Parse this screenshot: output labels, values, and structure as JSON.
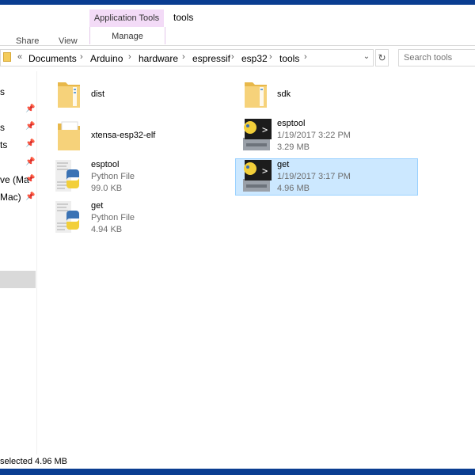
{
  "ribbon": {
    "tabs": [
      "Share",
      "View"
    ],
    "contextual_header": "Application Tools",
    "contextual_tab": "Manage"
  },
  "window": {
    "title": "tools"
  },
  "address": {
    "breadcrumbs": [
      "Documents",
      "Arduino",
      "hardware",
      "espressif",
      "esp32",
      "tools"
    ],
    "overflow": "«",
    "separator": "›"
  },
  "search": {
    "placeholder": "Search tools"
  },
  "nav": {
    "items": [
      "s",
      "s",
      "ts",
      "",
      "ve (Ma",
      "Mac)"
    ]
  },
  "files": [
    {
      "name": "dist",
      "type": "folder"
    },
    {
      "name": "sdk",
      "type": "folder"
    },
    {
      "name": "xtensa-esp32-elf",
      "type": "document-folder"
    },
    {
      "name": "esptool",
      "date": "1/19/2017 3:22 PM",
      "size": "3.29 MB",
      "type": "exe"
    },
    {
      "name": "esptool",
      "kind": "Python File",
      "size": "99.0 KB",
      "type": "python"
    },
    {
      "name": "get",
      "date": "1/19/2017 3:17 PM",
      "size": "4.96 MB",
      "type": "exe",
      "selected": true
    },
    {
      "name": "get",
      "kind": "Python File",
      "size": "4.94 KB",
      "type": "python"
    }
  ],
  "status": {
    "text": "selected  4.96 MB"
  },
  "colors": {
    "selection": "#cce8ff",
    "contextual": "#f3dbf7",
    "folder": "#f4cc5b",
    "frame": "#0a3d91"
  }
}
